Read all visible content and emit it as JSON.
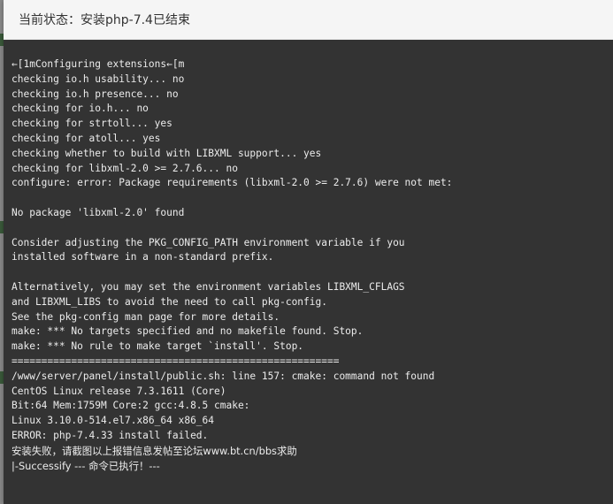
{
  "dialog": {
    "title": "当前状态：安装php-7.4已结束"
  },
  "console": {
    "lines": [
      "←[1mConfiguring extensions←[m",
      "checking io.h usability... no",
      "checking io.h presence... no",
      "checking for io.h... no",
      "checking for strtoll... yes",
      "checking for atoll... yes",
      "checking whether to build with LIBXML support... yes",
      "checking for libxml-2.0 >= 2.7.6... no",
      "configure: error: Package requirements (libxml-2.0 >= 2.7.6) were not met:",
      "",
      "No package 'libxml-2.0' found",
      "",
      "Consider adjusting the PKG_CONFIG_PATH environment variable if you",
      "installed software in a non-standard prefix.",
      "",
      "Alternatively, you may set the environment variables LIBXML_CFLAGS",
      "and LIBXML_LIBS to avoid the need to call pkg-config.",
      "See the pkg-config man page for more details.",
      "make: *** No targets specified and no makefile found. Stop.",
      "make: *** No rule to make target `install'. Stop.",
      "=======================================================",
      "/www/server/panel/install/public.sh: line 157: cmake: command not found",
      "CentOS Linux release 7.3.1611 (Core)",
      "Bit:64 Mem:1759M Core:2 gcc:4.8.5 cmake:",
      "Linux 3.10.0-514.el7.x86_64 x86_64",
      "ERROR: php-7.4.33 install failed.",
      "安装失败，请截图以上报错信息发帖至论坛www.bt.cn/bbs求助",
      "|-Successify --- 命令已执行！---"
    ]
  },
  "colors": {
    "console_bg": "#333333",
    "console_text": "#ececec",
    "header_bg": "#f5f5f5",
    "pager_active": "#20a53a"
  }
}
